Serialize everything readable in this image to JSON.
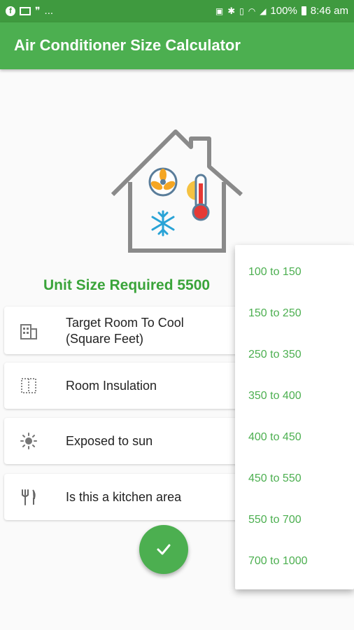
{
  "status_bar": {
    "icons": [
      "facebook-icon",
      "mail-icon",
      "quote-icon",
      "more-notifications-icon",
      "nfc-icon",
      "bluetooth-icon",
      "vibrate-icon",
      "wifi-icon",
      "signal-icon",
      "battery-icon"
    ],
    "more": "...",
    "battery": "100%",
    "time": "8:46 am"
  },
  "app_bar": {
    "title": "Air Conditioner Size Calculator"
  },
  "result": {
    "text": "Unit Size Required 5500"
  },
  "options": [
    {
      "icon": "building-icon",
      "label_line1": "Target Room To Cool",
      "label_line2": "(Square Feet)"
    },
    {
      "icon": "insulation-icon",
      "label_line1": "Room Insulation"
    },
    {
      "icon": "sun-icon",
      "label_line1": "Exposed to sun"
    },
    {
      "icon": "fork-knife-icon",
      "label_line1": "Is this a kitchen area"
    }
  ],
  "dropdown": {
    "options": [
      "100 to 150",
      "150 to 250",
      "250 to 350",
      "350 to 400",
      "400 to 450",
      "450 to 550",
      "550 to 700",
      "700 to 1000"
    ]
  },
  "colors": {
    "primary": "#4caf50",
    "status_bar": "#3f9a3f",
    "result_text": "#3aa43a"
  }
}
